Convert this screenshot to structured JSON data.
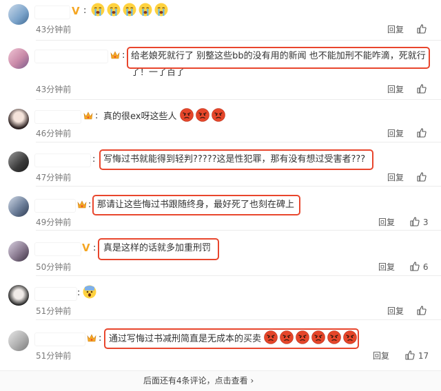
{
  "comments": [
    {
      "text": "😭😭😭😭😭",
      "time": "43分钟前",
      "reply": "回复",
      "likes": "",
      "badge": "V"
    },
    {
      "text": "给老娘死就行了 别整这些bb的没有用的新闻 也不能加刑不能咋滴，死就行了！一了百了",
      "time": "43分钟前",
      "reply": "回复",
      "likes": "",
      "badge": "crown"
    },
    {
      "text": "真的很ex呀这些人",
      "time": "46分钟前",
      "reply": "回复",
      "likes": "",
      "badge": "crown"
    },
    {
      "text": "写悔过书就能得到轻判?????这是性犯罪，那有没有想过受害者???",
      "time": "47分钟前",
      "reply": "回复",
      "likes": "",
      "badge": ""
    },
    {
      "text": "那请让这些悔过书跟随终身，最好死了也刻在碑上",
      "time": "49分钟前",
      "reply": "回复",
      "likes": "3",
      "badge": "crown"
    },
    {
      "text": "真是这样的话就多加重刑罚",
      "time": "50分钟前",
      "reply": "回复",
      "likes": "6",
      "badge": "V"
    },
    {
      "text": "",
      "time": "51分钟前",
      "reply": "回复",
      "likes": "",
      "badge": ""
    },
    {
      "text": "通过写悔过书减刑简直是无成本的买卖",
      "time": "51分钟前",
      "reply": "回复",
      "likes": "17",
      "badge": "crown"
    }
  ],
  "footer": {
    "text": "后面还有4条评论，点击查看 ›"
  },
  "colors": {
    "highlight": "#e8452c",
    "badge": "#f5a623"
  },
  "icons": {
    "like": "thumbs-up-icon",
    "angry": "angry-face-icon",
    "crying": "crying-face-icon",
    "scared": "scared-face-icon"
  }
}
